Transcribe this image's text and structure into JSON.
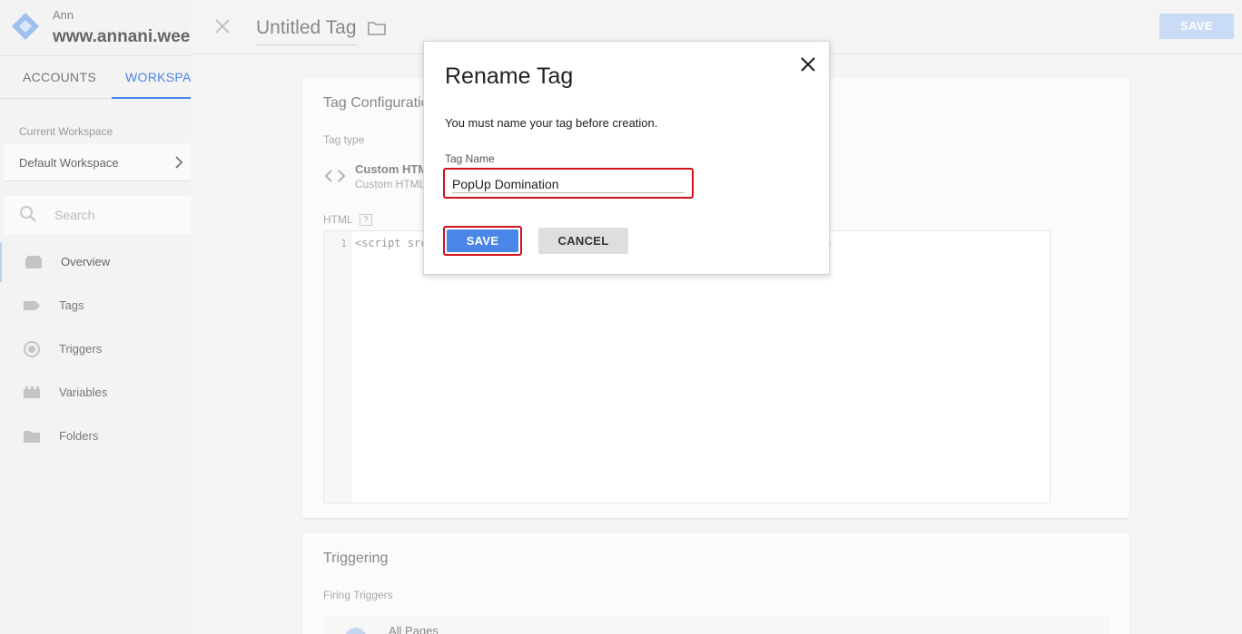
{
  "sidebar": {
    "account_label": "Ann",
    "container_name": "www.annani.wee",
    "tabs": [
      {
        "label": "ACCOUNTS"
      },
      {
        "label": "WORKSPACE"
      }
    ],
    "current_workspace_label": "Current Workspace",
    "current_workspace_name": "Default Workspace",
    "search_placeholder": "Search",
    "nav": [
      {
        "label": "Overview",
        "icon": "overview-icon"
      },
      {
        "label": "Tags",
        "icon": "tag-icon"
      },
      {
        "label": "Triggers",
        "icon": "trigger-icon"
      },
      {
        "label": "Variables",
        "icon": "variables-icon"
      },
      {
        "label": "Folders",
        "icon": "folder-icon"
      }
    ]
  },
  "editor": {
    "title": "Untitled Tag",
    "save_label": "SAVE",
    "config": {
      "title": "Tag Configuration",
      "tag_type_label": "Tag type",
      "tag_type_name": "Custom HTML",
      "tag_type_sub": "Custom HTML",
      "html_label": "HTML",
      "help": "?",
      "line_number": "1",
      "code": "<script src",
      "code_tail": ">"
    },
    "triggering": {
      "title": "Triggering",
      "firing_label": "Firing Triggers",
      "trigger_name": "All Pages"
    }
  },
  "dialog": {
    "title": "Rename Tag",
    "message": "You must name your tag before creation.",
    "field_label": "Tag Name",
    "field_value": "PopUp Domination",
    "save_label": "SAVE",
    "cancel_label": "CANCEL"
  },
  "colors": {
    "accent": "#4a86e8",
    "highlight": "#d4111b"
  }
}
